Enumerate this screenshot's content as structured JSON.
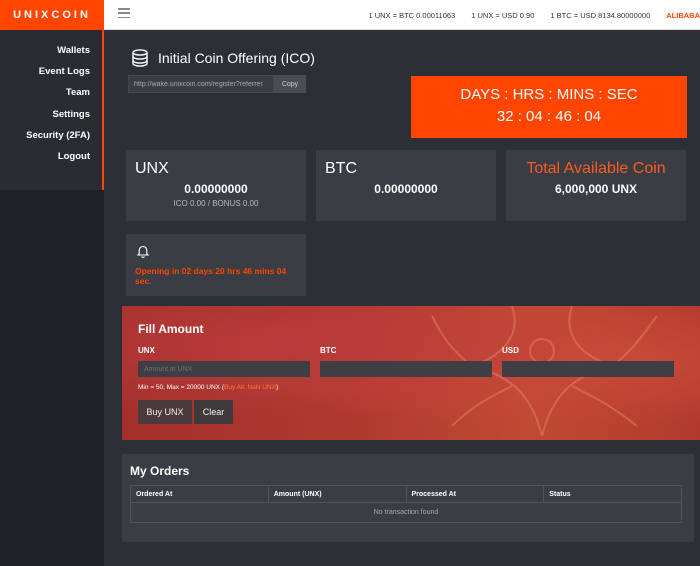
{
  "app": {
    "logo_text": "UNIXCOIN",
    "accent_color": "#ff4500"
  },
  "rates": [
    {
      "text": "1 UNX = BTC 0.00011063"
    },
    {
      "text": "1 UNX = USD 0.90"
    },
    {
      "text": "1 BTC = USD 8134.80000000"
    }
  ],
  "exchange_link": "ALIBABA",
  "sidebar": {
    "items": [
      {
        "label": "Wallets"
      },
      {
        "label": "Event Logs"
      },
      {
        "label": "Team"
      },
      {
        "label": "Settings"
      },
      {
        "label": "Security (2FA)"
      },
      {
        "label": "Logout"
      }
    ]
  },
  "ico": {
    "title": "Initial Coin Offering (ICO)",
    "referral_url": "http://wake.unixcoin.com/register?referrer",
    "copy_label": "Copy",
    "icon": "coins-stack-icon"
  },
  "countdown": {
    "labels": "DAYS : HRS : MINS : SEC",
    "values": "32 : 04 : 46 : 04"
  },
  "cards": {
    "unx": {
      "title": "UNX",
      "value": "0.00000000",
      "sub": "ICO 0.00 / BONUS 0.00"
    },
    "btc": {
      "title": "BTC",
      "value": "0.00000000"
    },
    "total": {
      "title": "Total Available Coin",
      "value": "6,000,000 UNX"
    }
  },
  "notice": {
    "icon": "bell-icon",
    "text": "Opening in 02 days 20 hrs 46 mins 04 sec."
  },
  "fill": {
    "title": "Fill Amount",
    "unx_label": "UNX",
    "btc_label": "BTC",
    "usd_label": "USD",
    "unx_placeholder": "Amount in UNX",
    "hint": "Min = 50, Max = 20000 UNX (",
    "hint_link": "Buy All: NaN UNX",
    "hint_end": ")",
    "buy_label": "Buy UNX",
    "clear_label": "Clear"
  },
  "orders": {
    "title": "My Orders",
    "columns": [
      "Ordered At",
      "Amount (UNX)",
      "Processed At",
      "Status"
    ],
    "empty_text": "No transaction found"
  }
}
